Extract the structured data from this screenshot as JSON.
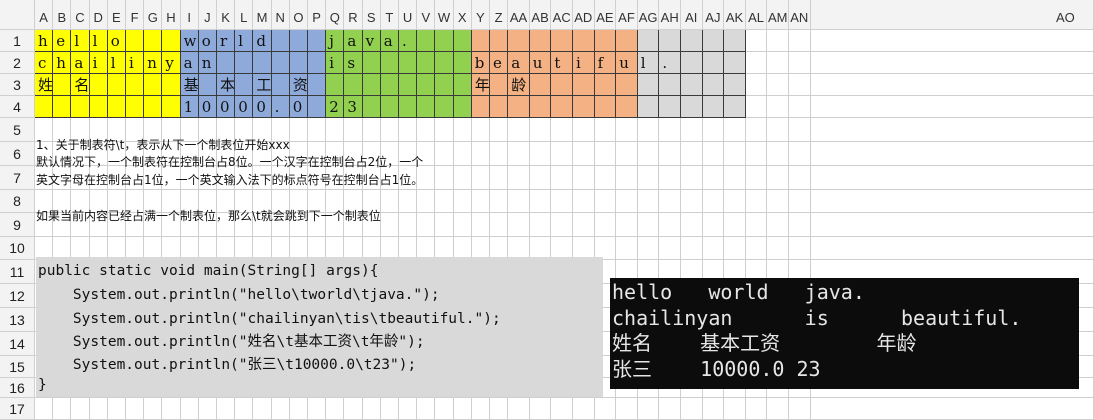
{
  "sheet": {
    "columns": [
      "A",
      "B",
      "C",
      "D",
      "E",
      "F",
      "G",
      "H",
      "I",
      "J",
      "K",
      "L",
      "M",
      "N",
      "O",
      "P",
      "Q",
      "R",
      "S",
      "T",
      "U",
      "V",
      "W",
      "X",
      "Y",
      "Z",
      "AA",
      "AB",
      "AC",
      "AD",
      "AE",
      "AF",
      "AG",
      "AH",
      "AI",
      "AJ",
      "AK",
      "AL",
      "AM",
      "AN",
      "AO"
    ],
    "rows": [
      "1",
      "2",
      "3",
      "4",
      "5",
      "6",
      "7",
      "8",
      "9",
      "10",
      "11",
      "12",
      "13",
      "14",
      "15",
      "16",
      "17"
    ],
    "colors": {
      "yellow": "#ffff00",
      "blue": "#8eaadb",
      "green": "#92d050",
      "orange": "#f4b183",
      "gray": "#d9d9d9",
      "code_bg": "#d9d9d9",
      "console_bg": "#0c0c0c"
    },
    "grid_rows": [
      {
        "row": 1,
        "cells": [
          "h",
          "e",
          "l",
          "l",
          "o",
          "",
          "",
          "",
          "w",
          "o",
          "r",
          "l",
          "d",
          "",
          "",
          "",
          "j",
          "a",
          "v",
          "a",
          "."
        ]
      },
      {
        "row": 2,
        "cells": [
          "c",
          "h",
          "a",
          "i",
          "l",
          "i",
          "n",
          "y",
          "a",
          "n",
          "",
          "",
          "",
          "",
          "",
          "",
          "i",
          "s",
          "",
          "",
          "",
          "",
          "",
          "",
          "b",
          "e",
          "a",
          "u",
          "t",
          "i",
          "f",
          "u",
          "l",
          "."
        ]
      },
      {
        "row": 3,
        "cells": [
          "姓",
          "",
          "名",
          "",
          "",
          "",
          "",
          "",
          "基",
          "",
          "本",
          "",
          "工",
          "",
          "资",
          "",
          "",
          "",
          "",
          "",
          "",
          "",
          "",
          "",
          "年",
          "",
          "龄"
        ]
      },
      {
        "row": 4,
        "cells": [
          "",
          "",
          "",
          "",
          "",
          "",
          "",
          "",
          "1",
          "0",
          "0",
          "0",
          "0",
          ".",
          "0",
          "",
          "2",
          "3"
        ]
      }
    ]
  },
  "notes": [
    "1、关于制表符\\t，表示从下一个制表位开始xxx",
    "默认情况下，一个制表符在控制台占8位。一个汉字在控制台占2位，一个",
    "英文字母在控制台占1位，一个英文输入法下的标点符号在控制台占1位。",
    "",
    "如果当前内容已经占满一个制表位，那么\\t就会跳到下一个制表位"
  ],
  "code": [
    "public static void main(String[] args){",
    "    System.out.println(\"hello\\tworld\\tjava.\");",
    "    System.out.println(\"chailinyan\\tis\\tbeautiful.\");",
    "    System.out.println(\"姓名\\t基本工资\\t年龄\");",
    "    System.out.println(\"张三\\t10000.0\\t23\");",
    "}"
  ],
  "console": [
    "hello   world   java.",
    "chailinyan      is      beautiful.",
    "姓名    基本工资        年龄",
    "张三    10000.0 23"
  ]
}
